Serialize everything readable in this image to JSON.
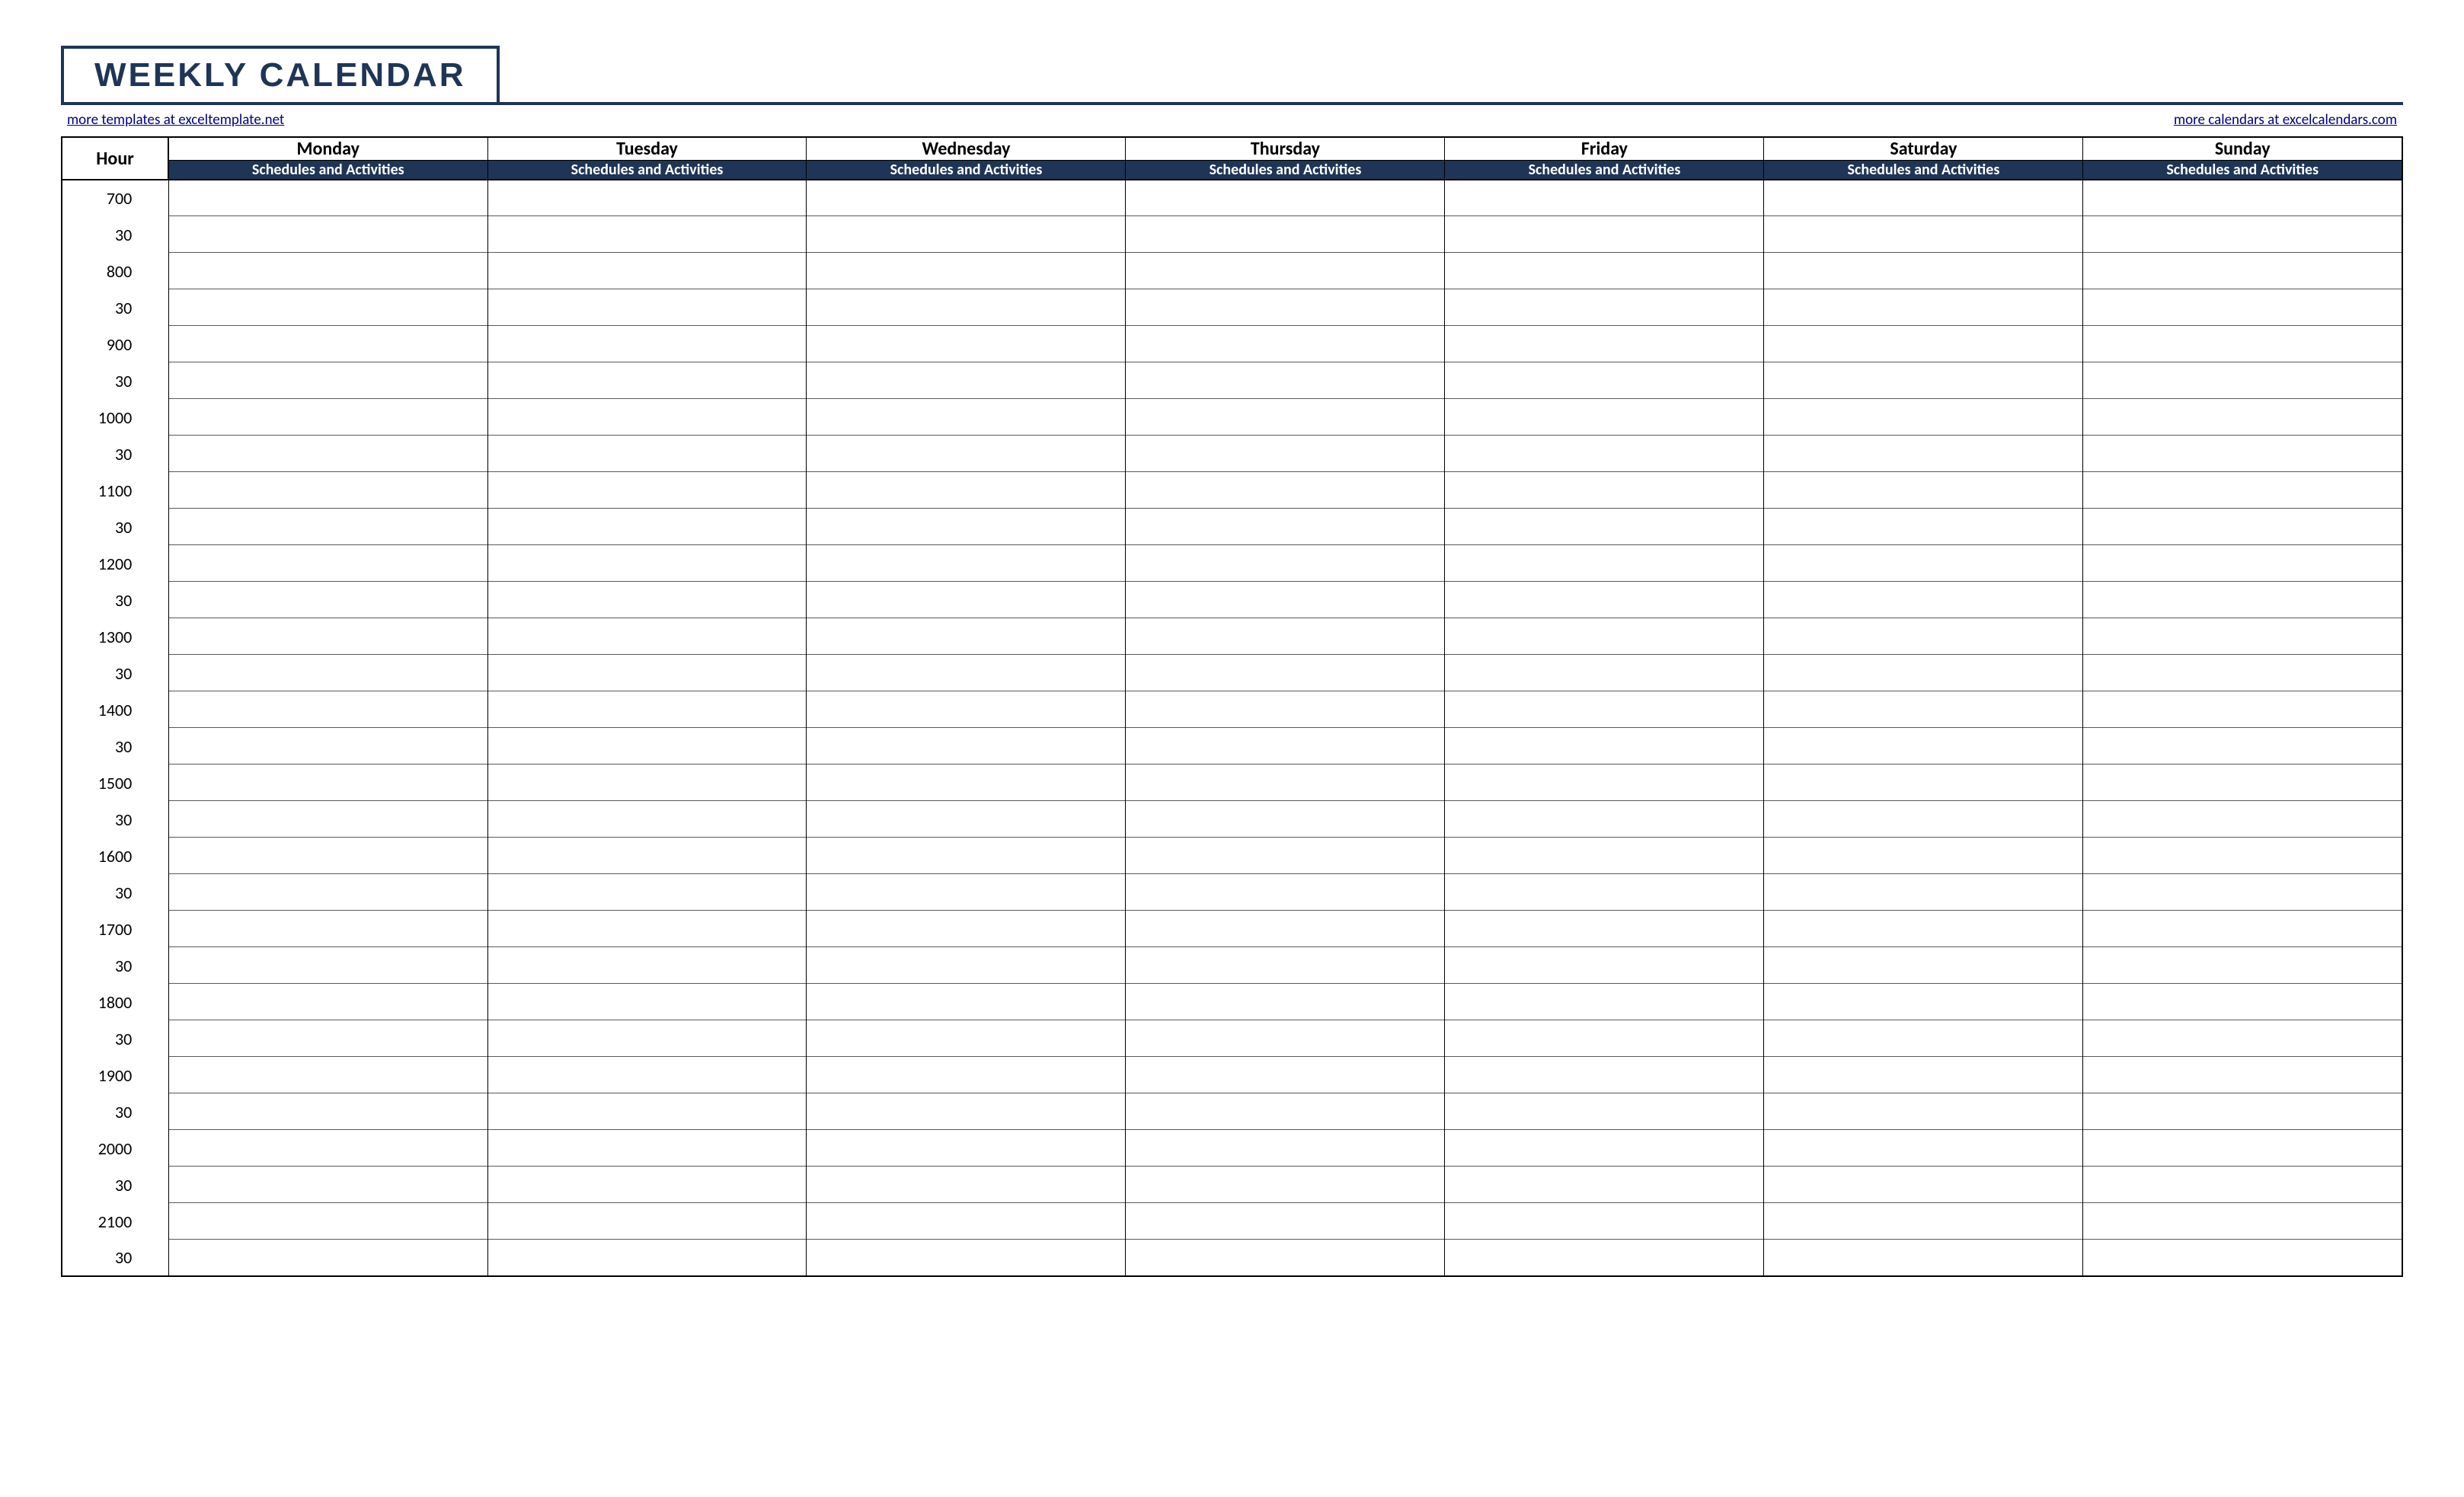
{
  "title": "WEEKLY CALENDAR",
  "link_left": "more templates at exceltemplate.net",
  "link_right": "more calendars at excelcalendars.com",
  "hour_header": "Hour",
  "subheader": "Schedules and Activities",
  "days": [
    "Monday",
    "Tuesday",
    "Wednesday",
    "Thursday",
    "Friday",
    "Saturday",
    "Sunday"
  ],
  "hours": [
    "7",
    "8",
    "9",
    "10",
    "11",
    "12",
    "13",
    "14",
    "15",
    "16",
    "17",
    "18",
    "19",
    "20",
    "21"
  ],
  "minutes_top": "00",
  "minutes_bottom": "30",
  "colors": {
    "accent": "#1e3556",
    "link": "#000080",
    "line": "#595959"
  }
}
